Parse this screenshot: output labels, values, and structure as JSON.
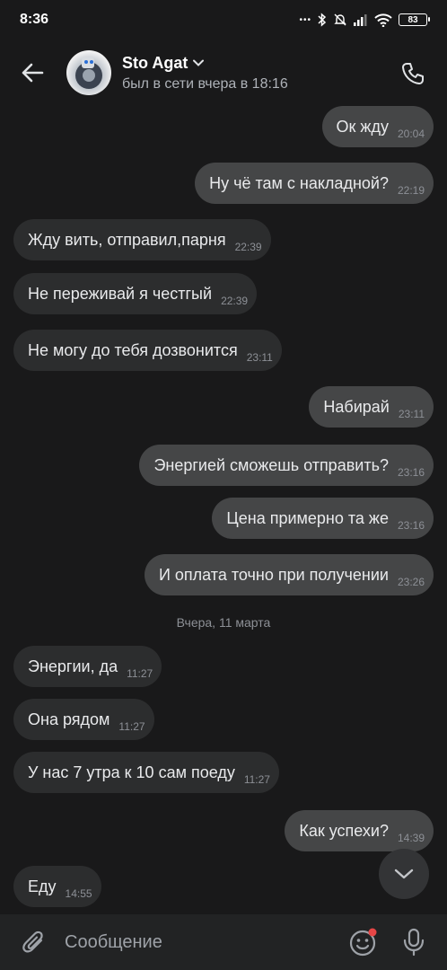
{
  "status_bar": {
    "time": "8:36",
    "dots": "•••",
    "battery": "83"
  },
  "header": {
    "contact_name": "Sto Agat",
    "contact_status": "был в сети вчера в 18:16"
  },
  "messages": [
    {
      "text": "Ок жду",
      "time": "20:04",
      "outgoing": true
    },
    {
      "text": "Ну чё там с накладной?",
      "time": "22:19",
      "outgoing": true
    },
    {
      "text": "Жду вить, отправил,парня",
      "time": "22:39",
      "outgoing": false
    },
    {
      "text": "Не переживай я честгый",
      "time": "22:39",
      "outgoing": false
    },
    {
      "text": "Не могу до тебя дозвонится",
      "time": "23:11",
      "outgoing": false
    },
    {
      "text": "Набирай",
      "time": "23:11",
      "outgoing": true
    },
    {
      "text": "Энергией сможешь отправить?",
      "time": "23:16",
      "outgoing": true
    },
    {
      "text": "Цена примерно та же",
      "time": "23:16",
      "outgoing": true
    },
    {
      "text": "И оплата точно при получении",
      "time": "23:26",
      "outgoing": true
    },
    {
      "text": "Энергии, да",
      "time": "11:27",
      "outgoing": false
    },
    {
      "text": "Она рядом",
      "time": "11:27",
      "outgoing": false
    },
    {
      "text": "У нас 7 утра к 10 сам поеду",
      "time": "11:27",
      "outgoing": false
    },
    {
      "text": "Как успехи?",
      "time": "14:39",
      "outgoing": true
    },
    {
      "text": "Еду",
      "time": "14:55",
      "outgoing": false
    }
  ],
  "date_separator": "Вчера, 11 марта",
  "composer": {
    "placeholder": "Сообщение"
  },
  "colors": {
    "background": "#19191a",
    "incoming_bubble": "#2c2d2e",
    "outgoing_bubble": "#454647",
    "notification_dot": "#e64646"
  },
  "icons": {
    "back": "arrow-left-icon",
    "call": "phone-icon",
    "dropdown": "chevron-down-icon",
    "scroll_down": "chevron-down-icon",
    "attach": "paperclip-icon",
    "sticker": "smiley-icon",
    "mic": "microphone-icon"
  }
}
